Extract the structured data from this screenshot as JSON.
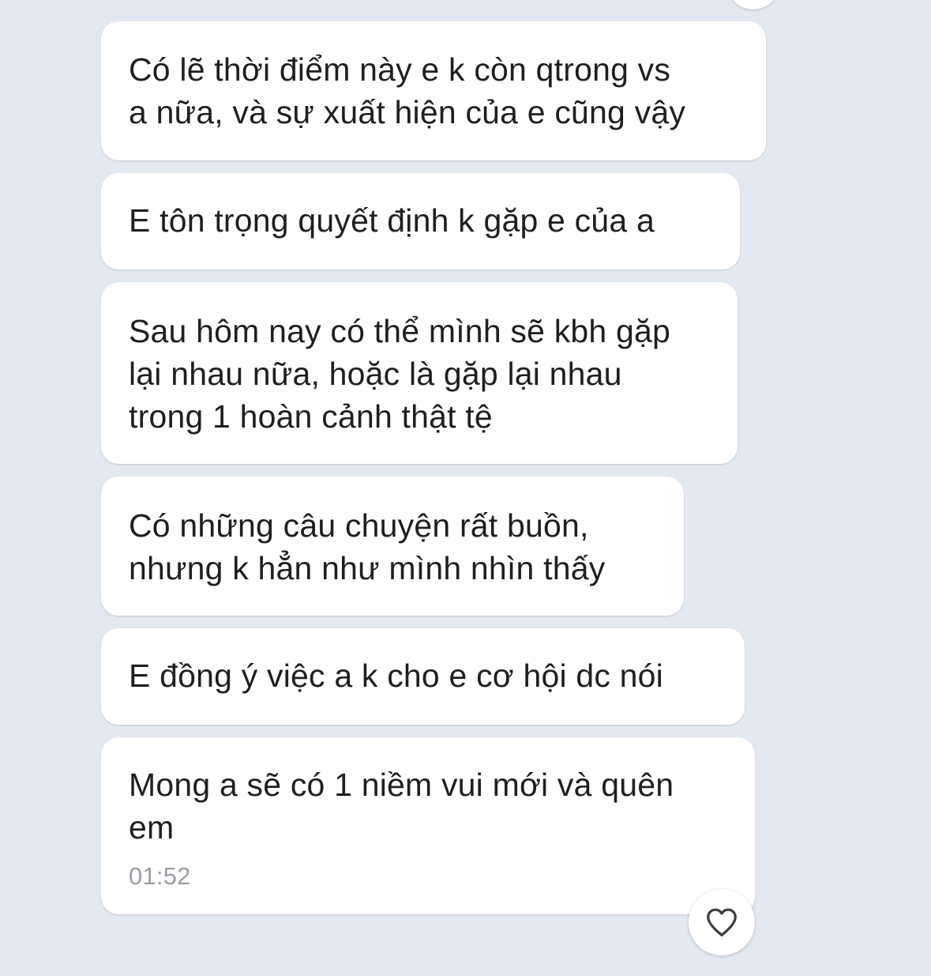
{
  "messages": [
    {
      "text": "Có lẽ thời điểm này e k còn qtrong vs\na nữa, và sự xuất hiện của e cũng vậy"
    },
    {
      "text": "E tôn trọng quyết định k gặp e của a"
    },
    {
      "text": "Sau hôm nay có thể mình sẽ kbh gặp\nlại nhau nữa, hoặc là gặp lại nhau\ntrong 1 hoàn cảnh thật tệ"
    },
    {
      "text": "Có những câu chuyện  rất buồn,\nnhưng k hẳn như mình nhìn thấy"
    },
    {
      "text": "E đồng ý việc a k cho e cơ hội dc nói"
    },
    {
      "text": "Mong a sẽ có 1 niềm vui mới và quên\nem",
      "time": "01:52"
    }
  ],
  "react_button": {
    "icon": "heart-outline-icon"
  },
  "colors": {
    "background": "#e2e9f1",
    "bubble": "#ffffff",
    "text": "#1f1f1f",
    "timestamp": "#9a9ea5",
    "icon": "#3c4045"
  }
}
